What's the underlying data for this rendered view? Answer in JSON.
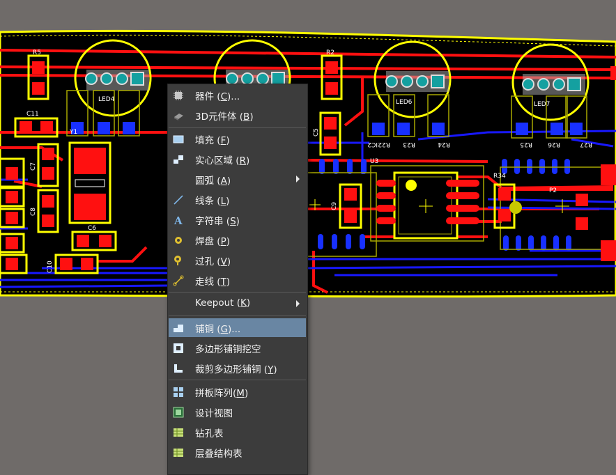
{
  "pcb": {
    "designators": [
      "R5",
      "LED4",
      "C11",
      "Y1",
      "C7",
      "C8",
      "C6",
      "C10",
      "R2",
      "C5",
      "U3",
      "C9",
      "LED6",
      "IC2",
      "R22",
      "R23",
      "R24",
      "R34",
      "LED7",
      "R25",
      "R26",
      "R27",
      "P2"
    ],
    "colors": {
      "background": "#000000",
      "top_layer": "#ff1010",
      "bottom_layer": "#1818ff",
      "overlay": "#ffff00",
      "mech": "#b8b800"
    }
  },
  "menu": {
    "items": [
      {
        "id": "components",
        "icon": "chip-icon",
        "text": "器件 (",
        "key": "C",
        "suffix": ")..."
      },
      {
        "id": "3d-body",
        "icon": "3d-body-icon",
        "text": "3D元件体 (",
        "key": "B",
        "suffix": ")"
      },
      {
        "id": "fill",
        "icon": "fill-icon",
        "text": "填充 (",
        "key": "F",
        "suffix": ")"
      },
      {
        "id": "solid-region",
        "icon": "region-icon",
        "text": "实心区域 (",
        "key": "R",
        "suffix": ")"
      },
      {
        "id": "arc",
        "icon": "arc-icon",
        "text": "圆弧 (",
        "key": "A",
        "suffix": ")",
        "submenu": true
      },
      {
        "id": "line",
        "icon": "line-icon",
        "text": "线条 (",
        "key": "L",
        "suffix": ")"
      },
      {
        "id": "string",
        "icon": "text-icon",
        "text": "字符串 (",
        "key": "S",
        "suffix": ")"
      },
      {
        "id": "pad",
        "icon": "pad-icon",
        "text": "焊盘 (",
        "key": "P",
        "suffix": ")"
      },
      {
        "id": "via",
        "icon": "via-icon",
        "text": "过孔 (",
        "key": "V",
        "suffix": ")"
      },
      {
        "id": "track",
        "icon": "track-icon",
        "text": "走线 (",
        "key": "T",
        "suffix": ")"
      },
      {
        "id": "keepout",
        "icon": "",
        "text": "Keepout (",
        "key": "K",
        "suffix": ")",
        "submenu": true
      },
      {
        "id": "polygon-pour",
        "icon": "polygon-pour-icon",
        "text": "铺铜 (",
        "key": "G",
        "suffix": ")...",
        "highlighted": true
      },
      {
        "id": "polygon-cutout",
        "icon": "cutout-icon",
        "text": "多边形铺铜挖空",
        "key": "",
        "suffix": ""
      },
      {
        "id": "slice-polygon",
        "icon": "slice-icon",
        "text": "裁剪多边形铺铜 (",
        "key": "Y",
        "suffix": ")"
      },
      {
        "id": "panel-array",
        "icon": "array-icon",
        "text": "拼板阵列(",
        "key": "M",
        "suffix": ")"
      },
      {
        "id": "design-view",
        "icon": "design-view-icon",
        "text": "设计视图",
        "key": "",
        "suffix": ""
      },
      {
        "id": "drill-table",
        "icon": "drill-table-icon",
        "text": "钻孔表",
        "key": "",
        "suffix": ""
      },
      {
        "id": "layer-stack-table",
        "icon": "layer-stack-icon",
        "text": "层叠结构表",
        "key": "",
        "suffix": ""
      }
    ]
  }
}
